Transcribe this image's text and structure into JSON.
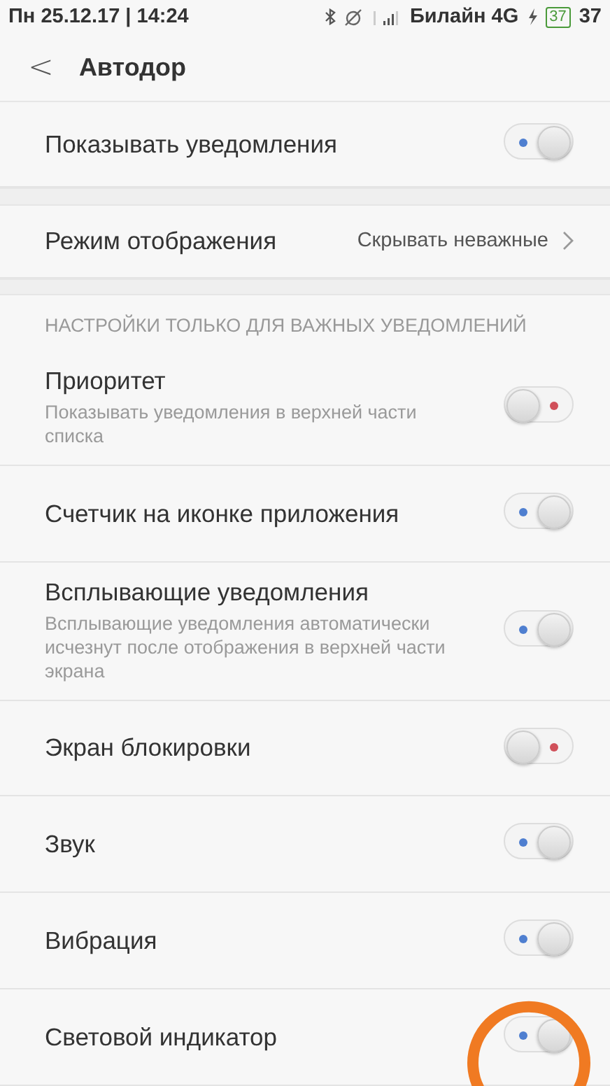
{
  "status_bar": {
    "datetime": "Пн 25.12.17 | 14:24",
    "carrier": "Билайн 4G",
    "battery_icon_text": "37",
    "battery": "37"
  },
  "header": {
    "back": "<",
    "title": "Автодор"
  },
  "sections": [
    {
      "rows": [
        {
          "kind": "toggle",
          "label": "Показывать уведомления",
          "on": true
        }
      ]
    },
    {
      "rows": [
        {
          "kind": "value",
          "label": "Режим отображения",
          "value": "Скрывать неважные"
        }
      ]
    },
    {
      "heading": "НАСТРОЙКИ ТОЛЬКО ДЛЯ ВАЖНЫХ УВЕДОМЛЕНИЙ",
      "rows": [
        {
          "kind": "toggle",
          "label": "Приоритет",
          "description": "Показывать уведомления в верхней части списка",
          "on": false
        },
        {
          "kind": "toggle",
          "label": "Счетчик на иконке приложения",
          "on": true
        },
        {
          "kind": "toggle",
          "label": "Всплывающие уведомления",
          "description": "Всплывающие уведомления автоматически исчезнут после отображения в верхней части экрана",
          "on": true
        },
        {
          "kind": "toggle",
          "label": "Экран блокировки",
          "on": false
        },
        {
          "kind": "toggle",
          "label": "Звук",
          "on": true
        },
        {
          "kind": "toggle",
          "label": "Вибрация",
          "on": true
        },
        {
          "kind": "toggle",
          "label": "Световой индикатор",
          "on": true,
          "highlighted": true
        }
      ]
    }
  ]
}
